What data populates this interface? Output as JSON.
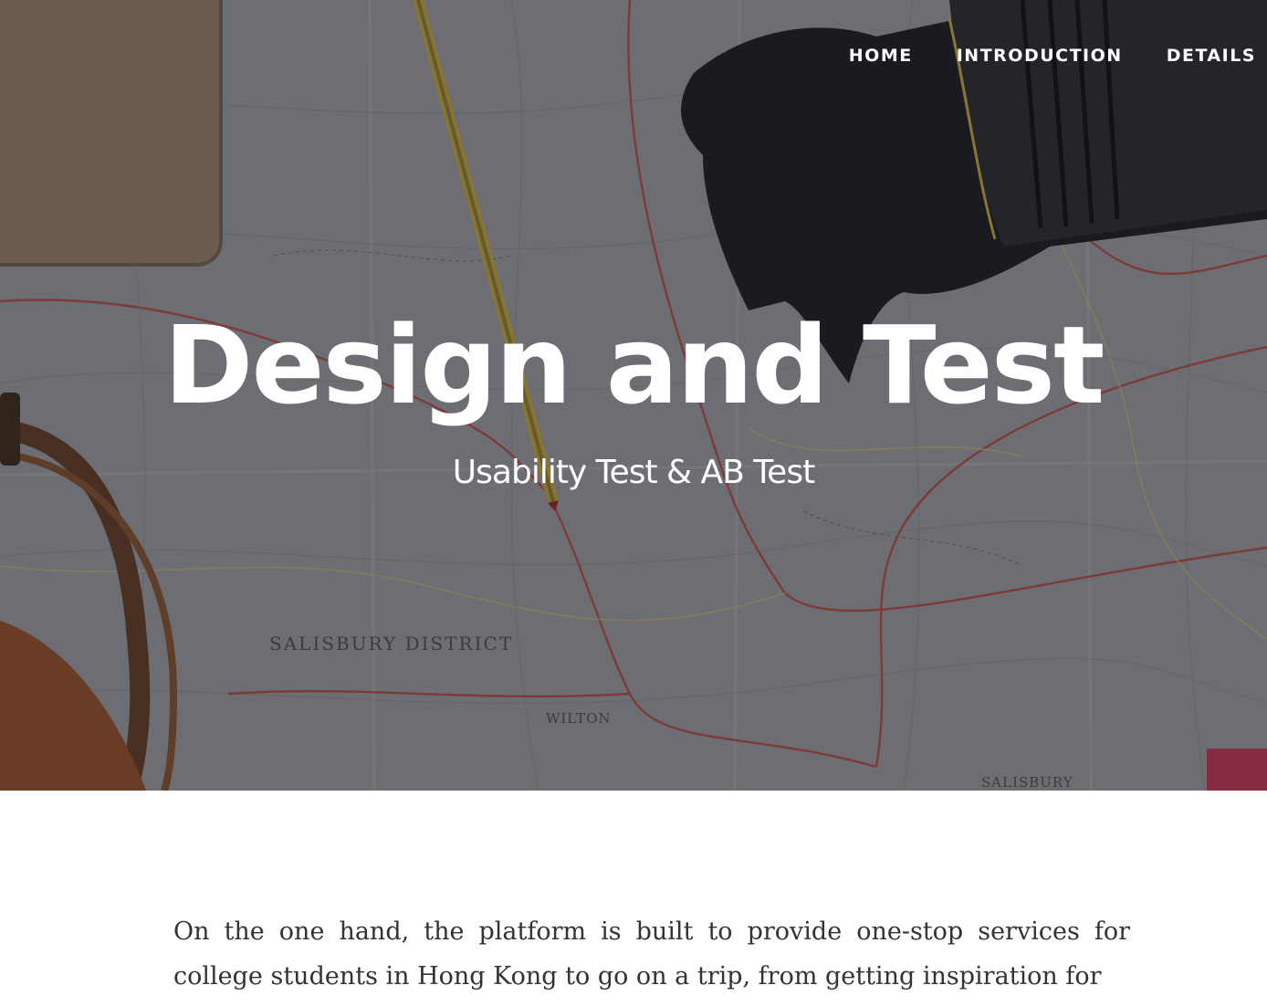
{
  "nav": {
    "items": [
      {
        "label": "HOME"
      },
      {
        "label": "INTRODUCTION"
      },
      {
        "label": "DETAILS"
      }
    ]
  },
  "hero": {
    "title": "Design and Test",
    "subtitle": "Usability Test & AB Test",
    "map_labels": [
      "SALISBURY DISTRICT",
      "WILTON",
      "SALISBURY"
    ]
  },
  "content": {
    "paragraph": "On the one hand, the platform is built to provide one-stop services for college students in Hong Kong to go on a trip, from getting inspiration for"
  },
  "colors": {
    "hero_overlay": "#14161c",
    "text_white": "#ffffff",
    "body_text": "#333333",
    "map_base": "#8e9095",
    "road_red": "#a8413a"
  }
}
